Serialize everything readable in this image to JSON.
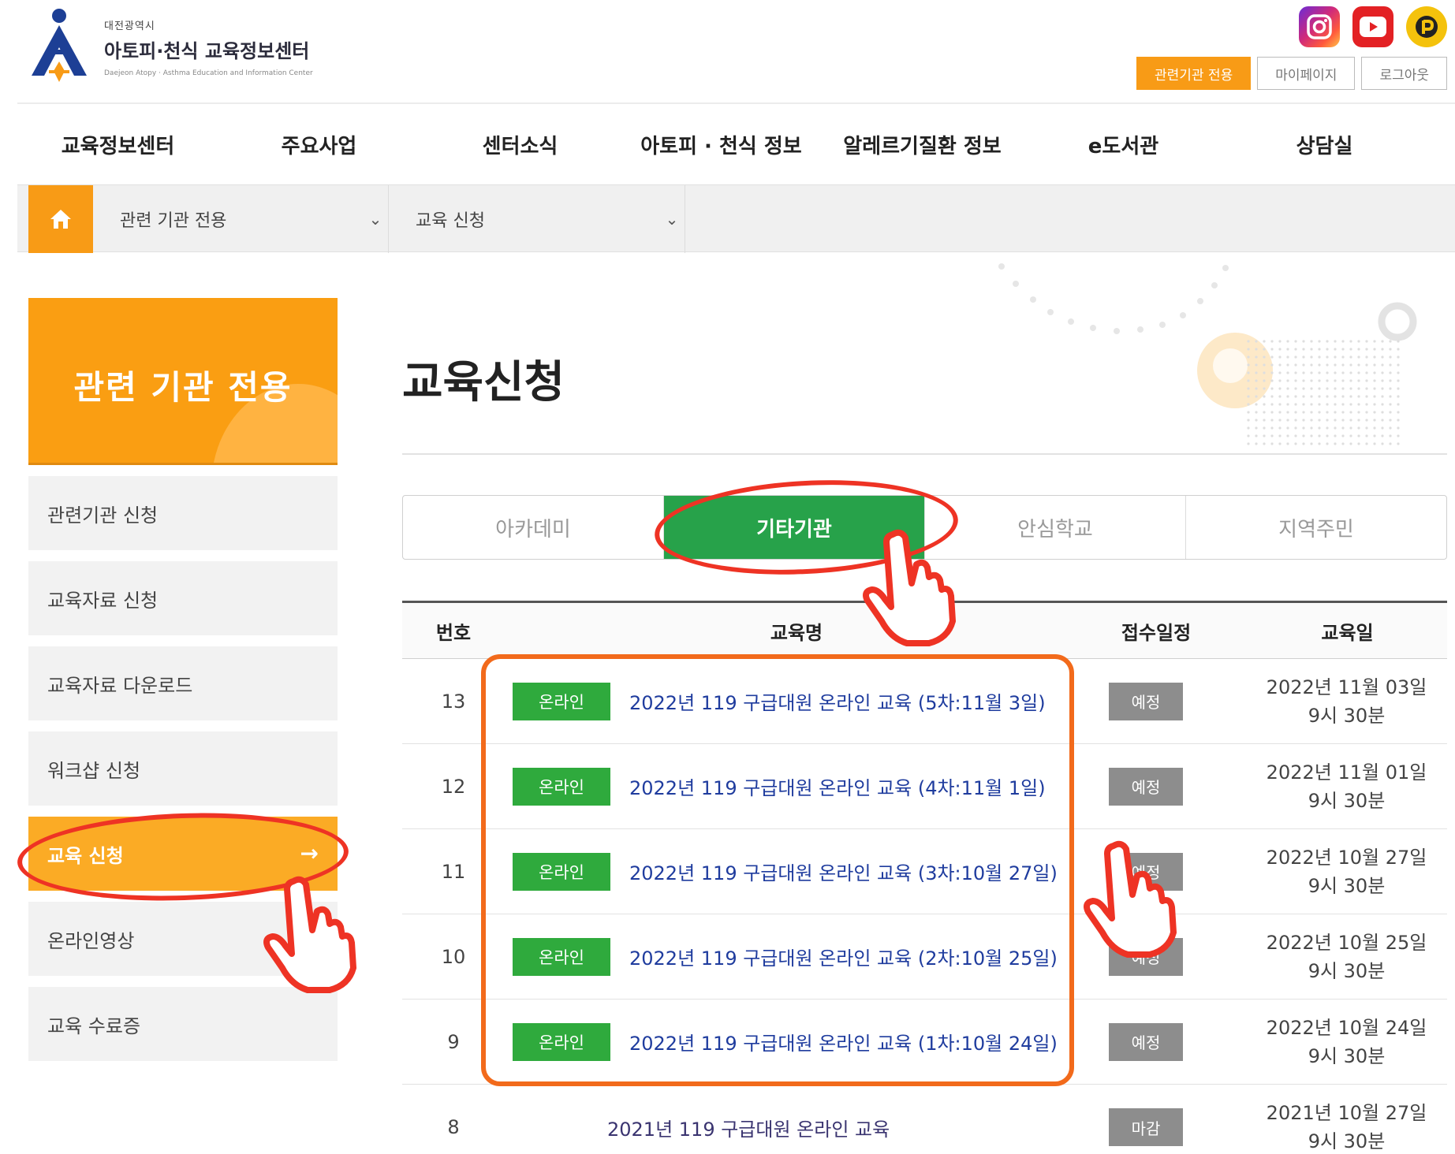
{
  "header": {
    "logo_sub": "대전광역시",
    "logo_main": "아토피·천식 교육정보센터",
    "logo_en": "Daejeon Atopy · Asthma Education and Information Center",
    "sns": [
      {
        "name": "instagram-icon"
      },
      {
        "name": "youtube-icon"
      },
      {
        "name": "kakao-icon"
      }
    ],
    "top_links": [
      "관련기관 전용",
      "마이페이지",
      "로그아웃"
    ]
  },
  "gnb": [
    "교육정보센터",
    "주요사업",
    "센터소식",
    "아토피 · 천식 정보",
    "알레르기질환 정보",
    "e도서관",
    "상담실"
  ],
  "location": {
    "level1": "관련 기관 전용",
    "level2": "교육 신청"
  },
  "sidebar": {
    "title": "관련 기관 전용",
    "items": [
      {
        "label": "관련기관 신청",
        "active": false
      },
      {
        "label": "교육자료 신청",
        "active": false
      },
      {
        "label": "교육자료 다운로드",
        "active": false
      },
      {
        "label": "워크샵 신청",
        "active": false
      },
      {
        "label": "교육 신청",
        "active": true
      },
      {
        "label": "온라인영상",
        "active": false
      },
      {
        "label": "교육 수료증",
        "active": false
      }
    ]
  },
  "page": {
    "title": "교육신청",
    "tabs": [
      {
        "label": "아카데미",
        "active": false
      },
      {
        "label": "기타기관",
        "active": true
      },
      {
        "label": "안심학교",
        "active": false
      },
      {
        "label": "지역주민",
        "active": false
      }
    ]
  },
  "table": {
    "headers": [
      "번호",
      "교육명",
      "접수일정",
      "교육일"
    ],
    "rows": [
      {
        "no": "13",
        "badge": "온라인",
        "title": "2022년 119 구급대원 온라인 교육 (5차:11월 3일)",
        "status": "예정",
        "date1": "2022년 11월 03일",
        "date2": "9시 30분"
      },
      {
        "no": "12",
        "badge": "온라인",
        "title": "2022년 119 구급대원 온라인 교육 (4차:11월 1일)",
        "status": "예정",
        "date1": "2022년 11월 01일",
        "date2": "9시 30분"
      },
      {
        "no": "11",
        "badge": "온라인",
        "title": "2022년 119 구급대원 온라인 교육 (3차:10월 27일)",
        "status": "예정",
        "date1": "2022년 10월 27일",
        "date2": "9시 30분"
      },
      {
        "no": "10",
        "badge": "온라인",
        "title": "2022년 119 구급대원 온라인 교육 (2차:10월 25일)",
        "status": "예정",
        "date1": "2022년 10월 25일",
        "date2": "9시 30분"
      },
      {
        "no": "9",
        "badge": "온라인",
        "title": "2022년 119 구급대원 온라인 교육 (1차:10월 24일)",
        "status": "예정",
        "date1": "2022년 10월 24일",
        "date2": "9시 30분"
      },
      {
        "no": "8",
        "badge": "",
        "title": "2021년 119 구급대원 온라인 교육",
        "status": "마감",
        "date1": "2021년 10월 27일",
        "date2": "9시 30분"
      }
    ]
  },
  "colors": {
    "accent_orange": "#f89b16",
    "tab_green": "#27a24a",
    "badge_green": "#2faa3d",
    "link_blue": "#1f3c9e",
    "annotation_red": "#ee3324",
    "annotation_orange": "#f26a1b"
  }
}
